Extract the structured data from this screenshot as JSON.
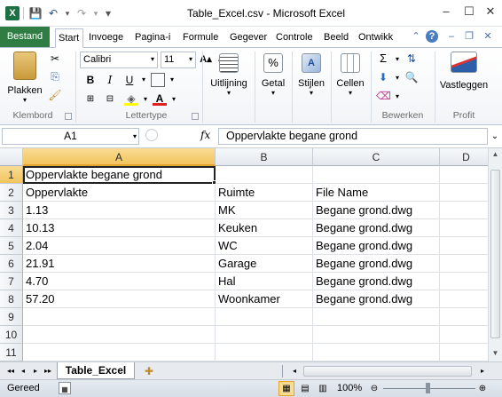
{
  "window": {
    "title": "Table_Excel.csv - Microsoft Excel",
    "app_icon": "X"
  },
  "quick_access": {
    "save_icon": "💾",
    "undo_icon": "↶",
    "redo_icon": "↷",
    "customize_icon": "▾"
  },
  "window_controls": {
    "minimize": "–",
    "maximize": "☐",
    "close": "✕"
  },
  "tabs": {
    "file": "Bestand",
    "items": [
      "Start",
      "Invoege",
      "Pagina-i",
      "Formule",
      "Gegever",
      "Controle",
      "Beeld",
      "Ontwikk"
    ]
  },
  "ribbon": {
    "clipboard": {
      "paste": "Plakken",
      "label": "Klembord"
    },
    "font": {
      "name": "Calibri",
      "size": "11",
      "bold": "B",
      "italic": "I",
      "underline": "U",
      "label": "Lettertype"
    },
    "alignment": {
      "label": "Uitlijning"
    },
    "number": {
      "label": "Getal",
      "symbol": "%"
    },
    "styles": {
      "label": "Stijlen"
    },
    "cells": {
      "label": "Cellen"
    },
    "editing": {
      "label": "Bewerken",
      "sum": "Σ"
    },
    "profit": {
      "button": "Vastleggen",
      "label": "Profit"
    }
  },
  "formula_bar": {
    "name_box": "A1",
    "fx": "fx",
    "content": "Oppervlakte begane grond"
  },
  "sheet": {
    "columns": [
      "A",
      "B",
      "C",
      "D"
    ],
    "rows": [
      {
        "n": "1",
        "a": "Oppervlakte begane grond",
        "b": "",
        "c": ""
      },
      {
        "n": "2",
        "a": "Oppervlakte",
        "b": "Ruimte",
        "c": "File Name"
      },
      {
        "n": "3",
        "a": "1.13",
        "b": "MK",
        "c": "Begane grond.dwg"
      },
      {
        "n": "4",
        "a": "10.13",
        "b": "Keuken",
        "c": "Begane grond.dwg"
      },
      {
        "n": "5",
        "a": "2.04",
        "b": "WC",
        "c": "Begane grond.dwg"
      },
      {
        "n": "6",
        "a": "21.91",
        "b": "Garage",
        "c": "Begane grond.dwg"
      },
      {
        "n": "7",
        "a": "4.70",
        "b": "Hal",
        "c": "Begane grond.dwg"
      },
      {
        "n": "8",
        "a": "57.20",
        "b": "Woonkamer",
        "c": "Begane grond.dwg"
      },
      {
        "n": "9",
        "a": "",
        "b": "",
        "c": ""
      },
      {
        "n": "10",
        "a": "",
        "b": "",
        "c": ""
      },
      {
        "n": "11",
        "a": "",
        "b": "",
        "c": ""
      }
    ]
  },
  "sheet_tabs": {
    "active": "Table_Excel",
    "nav": [
      "◂◂",
      "◂",
      "▸",
      "▸▸"
    ]
  },
  "status": {
    "ready": "Gereed",
    "zoom": "100%"
  },
  "colors": {
    "file_tab": "#2f7d43",
    "selected_header": "#f2c45d"
  }
}
